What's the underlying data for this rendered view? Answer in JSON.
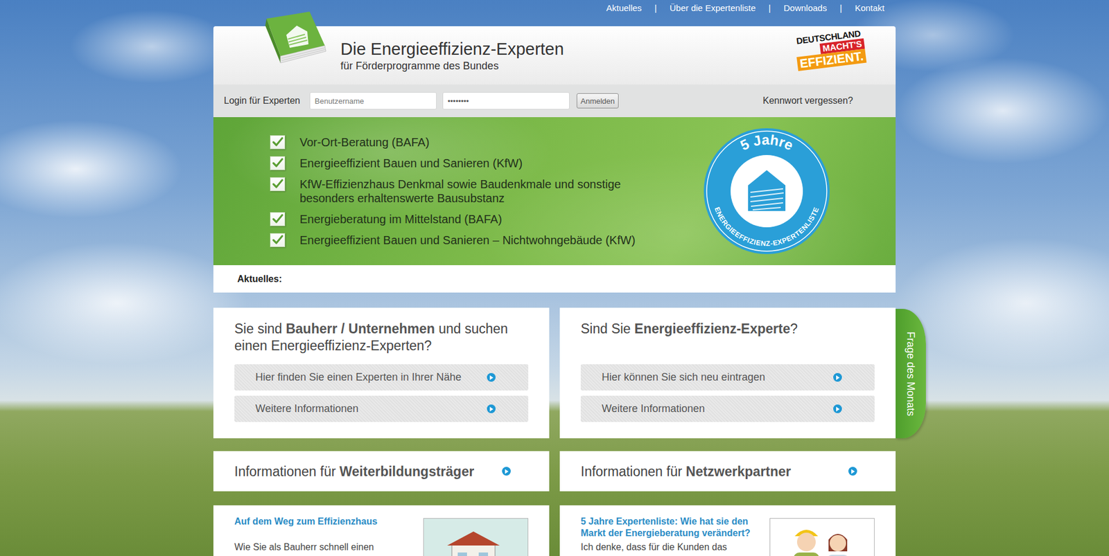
{
  "nav": {
    "items": [
      {
        "label": "Aktuelles"
      },
      {
        "label": "Über die Expertenliste"
      },
      {
        "label": "Downloads"
      },
      {
        "label": "Kontakt"
      }
    ],
    "separator": "|"
  },
  "header": {
    "title": "Die Energieeffizienz-Experten",
    "subtitle": "für Förderprogramme des Bundes",
    "campaign": [
      "DEUTSCHLAND",
      "MACHT'S",
      "EFFIZIENT."
    ]
  },
  "login": {
    "label": "Login für Experten",
    "username_placeholder": "Benutzername",
    "password": "••••••••",
    "button": "Anmelden",
    "forgot": "Kennwort vergessen?"
  },
  "programs": [
    {
      "label": "Vor-Ort-Beratung (BAFA)",
      "checked": true
    },
    {
      "label": "Energieeffizient Bauen und Sanieren (KfW)",
      "checked": true
    },
    {
      "label": "KfW-Effizienzhaus Denkmal sowie Baudenkmale und sonstige besonders erhaltenswerte Bausubstanz",
      "checked": true
    },
    {
      "label": "Energieberatung im Mittelstand (BAFA)",
      "checked": true
    },
    {
      "label": "Energieeffizient Bauen und Sanieren – Nichtwohngebäude (KfW)",
      "checked": true
    }
  ],
  "badge": {
    "top": "5 Jahre",
    "ring": "ENERGIEEFFIZIENZ-EXPERTENLISTE"
  },
  "news": {
    "label": "Aktuelles:"
  },
  "cards": [
    {
      "title": [
        {
          "text": "Sie sind ",
          "bold": false
        },
        {
          "text": "Bauherr / Unternehmen",
          "bold": true
        },
        {
          "text": " und suchen einen Energieeffizienz-Experten?",
          "bold": false
        }
      ],
      "buttons": [
        "Hier finden Sie einen Experten in Ihrer Nähe",
        "Weitere Informationen"
      ]
    },
    {
      "title": [
        {
          "text": "Sind Sie ",
          "bold": false
        },
        {
          "text": "Energieeffizienz-Experte",
          "bold": true
        },
        {
          "text": "?",
          "bold": false
        }
      ],
      "buttons": [
        "Hier können Sie sich neu eintragen",
        "Weitere Informationen"
      ]
    }
  ],
  "side_tab": {
    "label": "Frage des Monats"
  },
  "info_links": [
    {
      "parts": [
        {
          "text": "Informationen für ",
          "bold": false
        },
        {
          "text": "Weiterbildungsträger",
          "bold": true
        }
      ]
    },
    {
      "parts": [
        {
          "text": "Informationen für ",
          "bold": false
        },
        {
          "text": "Netzwerkpartner",
          "bold": true
        }
      ]
    }
  ],
  "articles": [
    {
      "title": "Auf dem Weg zum Effizienzhaus",
      "text": "Wie Sie als Bauherr schnell einen"
    },
    {
      "title": "5 Jahre Expertenliste: Wie hat sie den Markt der Energieberatung verändert?",
      "text": "Ich denke, dass für die Kunden das"
    }
  ]
}
